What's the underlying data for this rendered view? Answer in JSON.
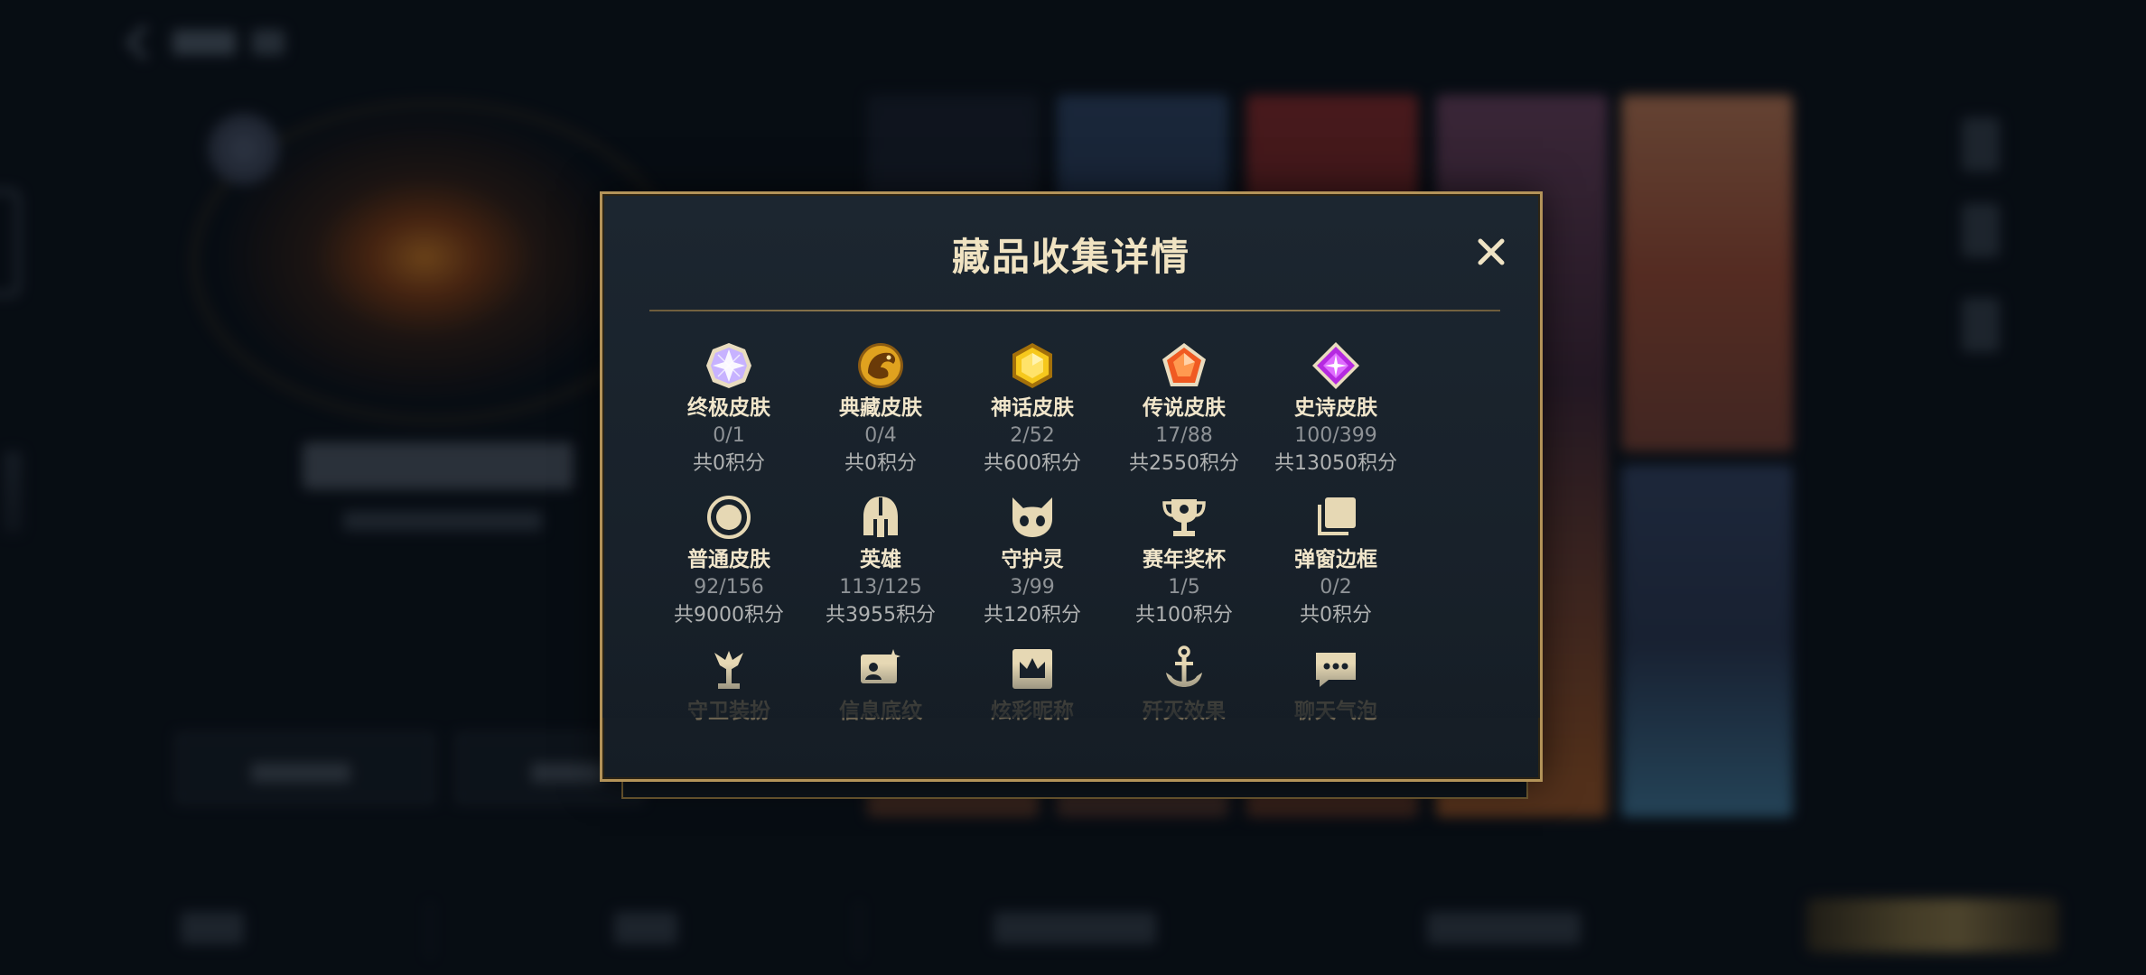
{
  "modal": {
    "title": "藏品收集详情",
    "close_icon": "close-icon"
  },
  "categories": [
    {
      "label": "终极皮肤",
      "count": "0/1",
      "points": "共0积分",
      "icon": "ultimate-gem-icon",
      "color": "#b79bff"
    },
    {
      "label": "典藏皮肤",
      "count": "0/4",
      "points": "共0积分",
      "icon": "dragon-emblem-icon",
      "color": "#e3a520"
    },
    {
      "label": "神话皮肤",
      "count": "2/52",
      "points": "共600积分",
      "icon": "mythic-gem-icon",
      "color": "#f2c21b"
    },
    {
      "label": "传说皮肤",
      "count": "17/88",
      "points": "共2550积分",
      "icon": "legend-gem-icon",
      "color": "#f26a2a"
    },
    {
      "label": "史诗皮肤",
      "count": "100/399",
      "points": "共13050积分",
      "icon": "epic-gem-icon",
      "color": "#c23ae6"
    },
    {
      "label": "普通皮肤",
      "count": "92/156",
      "points": "共9000积分",
      "icon": "circle-badge-icon",
      "color": "#e6d8b4"
    },
    {
      "label": "英雄",
      "count": "113/125",
      "points": "共3955积分",
      "icon": "helmet-icon",
      "color": "#e6d8b4"
    },
    {
      "label": "守护灵",
      "count": "3/99",
      "points": "共120积分",
      "icon": "guardian-pet-icon",
      "color": "#e6d8b4"
    },
    {
      "label": "赛年奖杯",
      "count": "1/5",
      "points": "共100积分",
      "icon": "trophy-icon",
      "color": "#e6d8b4"
    },
    {
      "label": "弹窗边框",
      "count": "0/2",
      "points": "共0积分",
      "icon": "frame-stack-icon",
      "color": "#e6d8b4"
    },
    {
      "label": "守卫装扮",
      "icon": "ward-icon",
      "color": "#e6d8b4"
    },
    {
      "label": "信息底纹",
      "icon": "profile-card-icon",
      "color": "#e6d8b4"
    },
    {
      "label": "炫彩昵称",
      "icon": "crown-name-icon",
      "color": "#e6d8b4"
    },
    {
      "label": "歼灭效果",
      "icon": "anchor-effect-icon",
      "color": "#e6d8b4"
    },
    {
      "label": "聊天气泡",
      "icon": "chat-bubble-icon",
      "color": "#e6d8b4"
    }
  ],
  "colors": {
    "modal_border": "#b39359",
    "title_text": "#f0e3c2",
    "count_text": "#8e9296",
    "points_text": "#b0b2b2"
  }
}
